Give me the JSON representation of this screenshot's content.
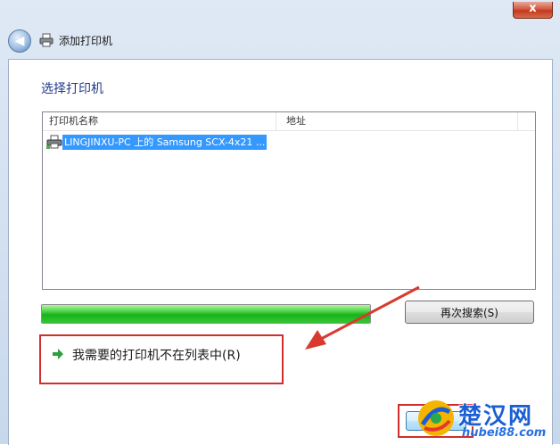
{
  "window": {
    "close_glyph": "x"
  },
  "nav": {
    "back_icon": "back-arrow-icon",
    "title": "添加打印机"
  },
  "page": {
    "title": "选择打印机"
  },
  "printer_list": {
    "columns": [
      "打印机名称",
      "地址"
    ],
    "rows": [
      {
        "name": "LINGJINXU-PC 上的 Samsung SCX-4x21 ...",
        "address": "",
        "icon": "printer-icon",
        "selected": true
      }
    ]
  },
  "search": {
    "progress": 1.0,
    "progress_color": "#32c832",
    "button_label": "再次搜索(S)"
  },
  "not_listed_link": {
    "icon": "green-arrow-icon",
    "label": "我需要的打印机不在列表中(R)"
  },
  "annotation": {
    "color": "#d02e2e"
  },
  "watermark": {
    "text": "楚汉网",
    "url": "hubei88.com"
  }
}
